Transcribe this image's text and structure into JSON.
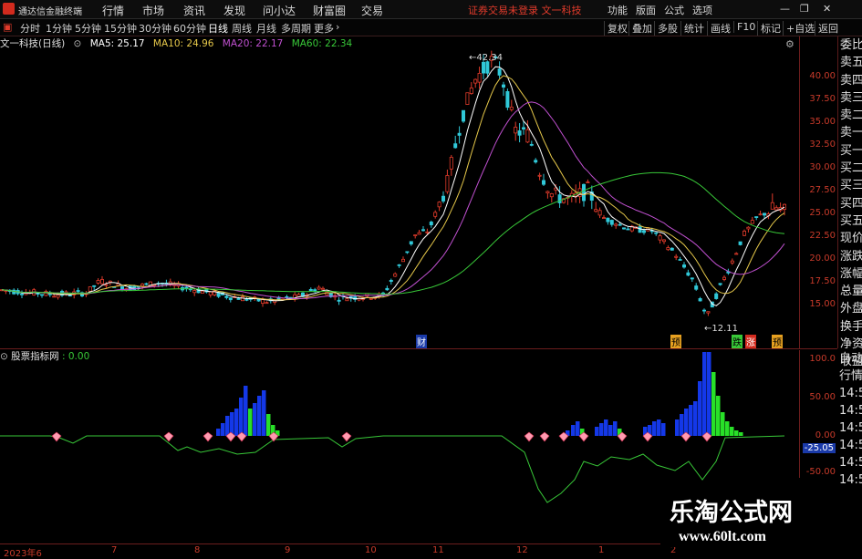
{
  "menubar": {
    "app_title": "通达信金融终端",
    "menu": [
      "行情",
      "市场",
      "资讯",
      "发现",
      "问小达",
      "财富圈",
      "交易"
    ],
    "center_text": "证券交易未登录 文一科技",
    "right": [
      "功能",
      "版面",
      "公式",
      "选项"
    ]
  },
  "periodbar": {
    "periods": [
      "分时",
      "1分钟",
      "5分钟",
      "15分钟",
      "30分钟",
      "60分钟",
      "日线",
      "周线",
      "月线",
      "多周期",
      "更多"
    ],
    "active": "日线",
    "tools": [
      "复权",
      "叠加",
      "多股",
      "统计",
      "画线",
      "F10",
      "标记",
      "+自选",
      "返回"
    ]
  },
  "chart_info": {
    "stock": "文一科技(日线)",
    "ma5": "MA5: 25.17",
    "ma10": "MA10: 24.96",
    "ma20": "MA20: 22.17",
    "ma60": "MA60: 22.34",
    "high_label": "42.34",
    "low_label": "12.11",
    "colors": {
      "ma5": "#ffffff",
      "ma10": "#e6c84a",
      "ma20": "#c050d0",
      "ma60": "#38c838"
    }
  },
  "price_axis": [
    "40.00",
    "37.50",
    "35.00",
    "32.50",
    "30.00",
    "27.50",
    "25.00",
    "22.50",
    "20.00",
    "17.50",
    "15.00"
  ],
  "markers": [
    "财",
    "预",
    "跌",
    "涨",
    "预"
  ],
  "side_panel": [
    "委比",
    "卖五",
    "卖四",
    "卖三",
    "卖二",
    "卖一",
    "买一",
    "买二",
    "买三",
    "买四",
    "买五",
    "现价",
    "涨跌",
    "涨幅",
    "总量",
    "外盘",
    "换手",
    "净资",
    "收益"
  ],
  "side_panel2": [
    "自动",
    "行情",
    "14:50",
    "14:50",
    "14:50",
    "14:50",
    "14:50",
    "14:50"
  ],
  "sub_chart": {
    "name": "股票指标网",
    "value": ": 0.00",
    "axis": [
      "100.0",
      "50.00",
      "0.00",
      "-25.05",
      "-50.00"
    ]
  },
  "x_axis": [
    "2023年6",
    "7",
    "8",
    "9",
    "10",
    "11",
    "12",
    "1",
    "2"
  ],
  "watermark": {
    "line1": "乐淘公式网",
    "line2": "www.60lt.com"
  },
  "chart_data": {
    "type": "candlestick",
    "ylim": [
      12.11,
      42.34
    ],
    "high": 42.34,
    "low": 12.11,
    "moving_averages": {
      "MA5": 25.17,
      "MA10": 24.96,
      "MA20": 22.17,
      "MA60": 22.34
    }
  }
}
